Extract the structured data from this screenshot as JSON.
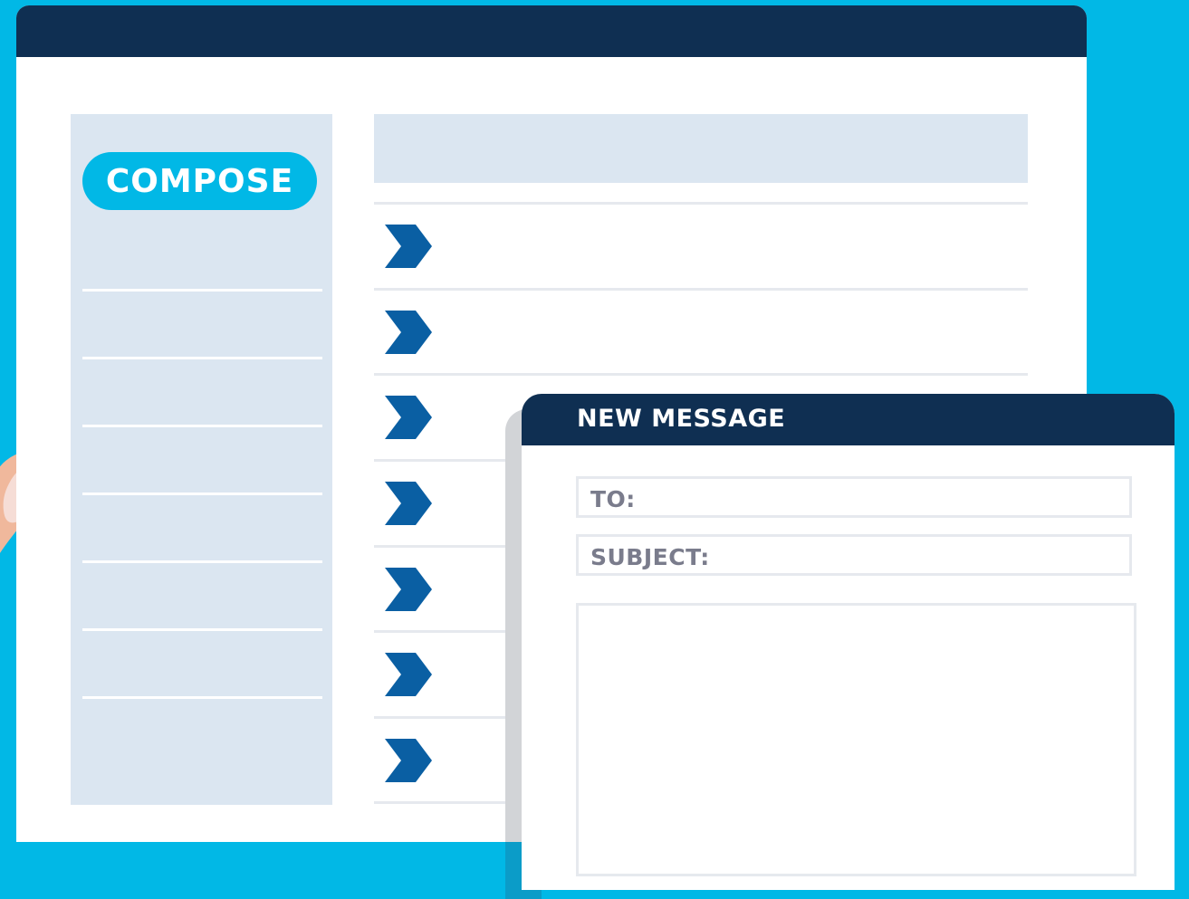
{
  "colors": {
    "background": "#01b8e6",
    "titlebar": "#0f2f52",
    "panel": "#dbe6f1",
    "accent": "#01b8e6",
    "chevron": "#0a5fa3",
    "field_label": "#7a7c8c"
  },
  "sidebar": {
    "compose_label": "COMPOSE",
    "folder_count": 7
  },
  "message_list": {
    "row_icon": "chevron-right-icon",
    "row_count": 7
  },
  "compose_window": {
    "title": "NEW MESSAGE",
    "to_label": "TO:",
    "subject_label": "SUBJECT:"
  }
}
